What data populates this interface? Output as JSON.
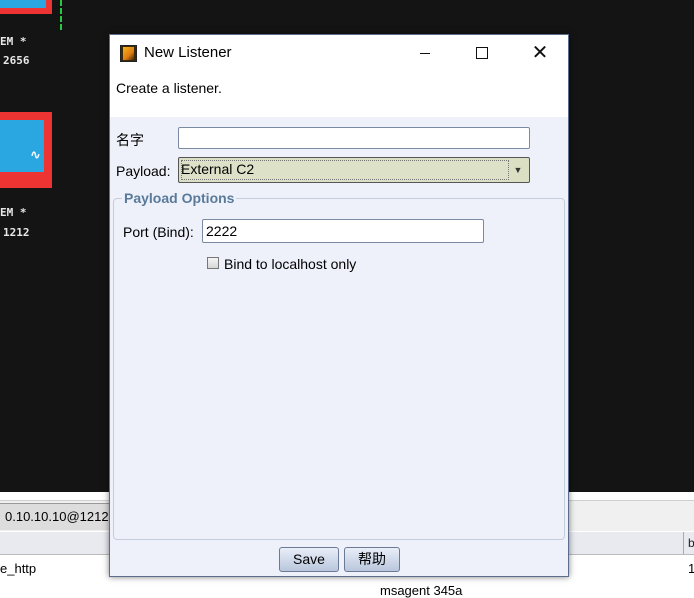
{
  "window": {
    "title": "New Listener",
    "description": "Create a listener."
  },
  "form": {
    "name_label": "名字",
    "name_value": "",
    "payload_label": "Payload:",
    "payload_value": "External C2",
    "payload_options_title": "Payload Options",
    "port_label": "Port (Bind):",
    "port_value": "2222",
    "bind_localhost_label": "Bind to localhost only",
    "bind_localhost_checked": false
  },
  "buttons": {
    "save": "Save",
    "help": "帮助"
  },
  "background": {
    "hosts": [
      {
        "user": "EM *",
        "pid": "2656"
      },
      {
        "user": "EM *",
        "pid": "1212"
      }
    ],
    "tab_label": "0.10.10.10@1212",
    "table": {
      "col_b": "b",
      "row1_col1": "e_http",
      "row1_col_b": "1",
      "row2_text": "msagent  345a"
    }
  },
  "colors": {
    "dialog_bg": "#eef1fa",
    "graph_bg": "#141414",
    "host_frame": "#e33333",
    "host_screen": "#2aa6e0",
    "group_title": "#5a7a9a"
  }
}
